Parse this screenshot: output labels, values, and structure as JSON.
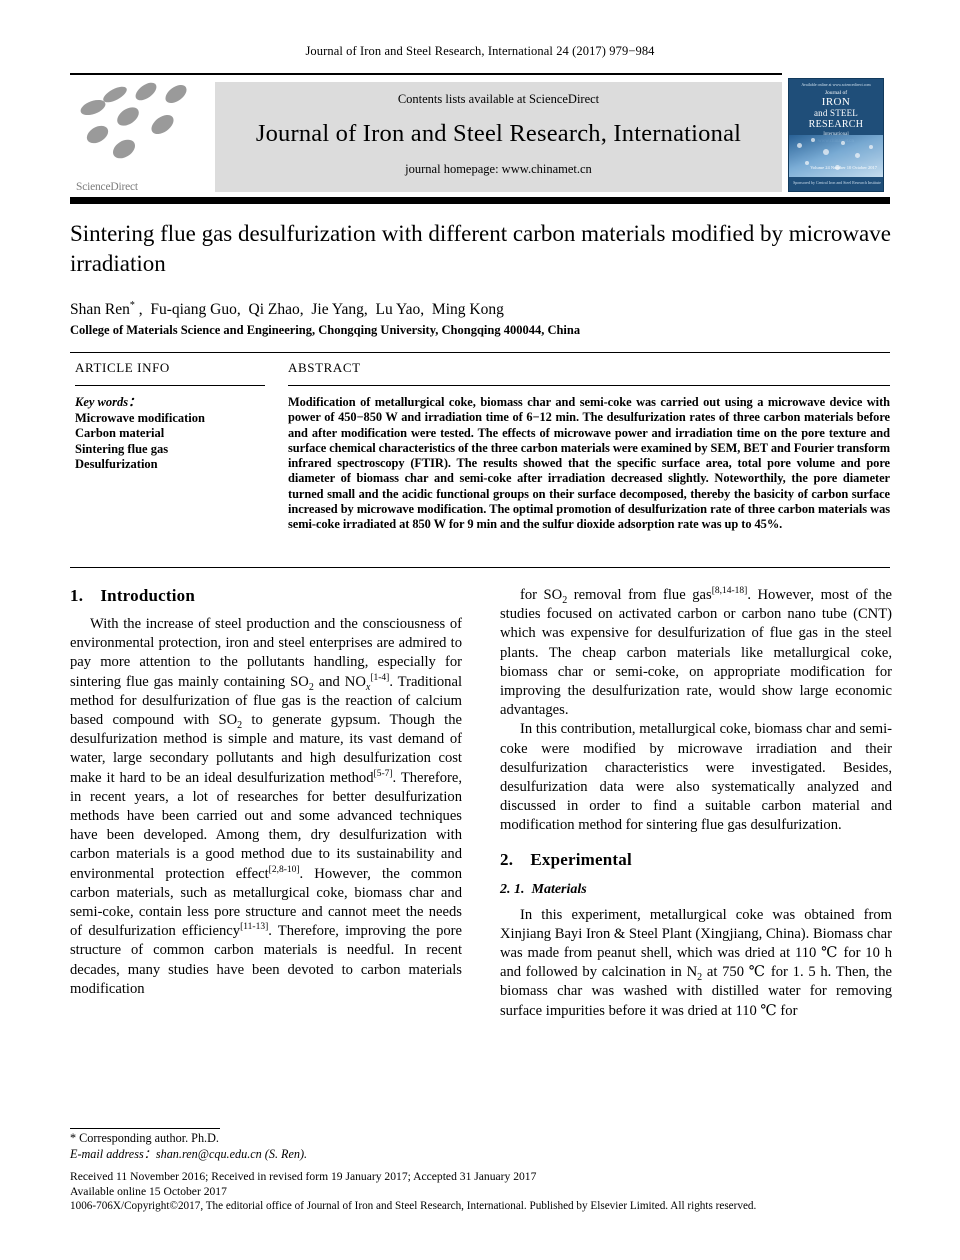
{
  "running_head": "Journal of Iron and Steel Research, International 24 (2017) 979−984",
  "masthead": {
    "contents_line": "Contents lists available at ScienceDirect",
    "journal_title": "Journal of Iron and Steel Research, International",
    "homepage_line": "journal homepage: www.chinamet.cn",
    "sciencedirect_label": "ScienceDirect",
    "cover": {
      "line_tiny": "Available online at www.sciencedirect.com",
      "line1": "Journal of",
      "line2": "IRON",
      "line3": "and STEEL",
      "line4": "RESEARCH",
      "line5": "International",
      "line6": "www.chinamet.cn",
      "issue": "Volume 24  Number 10\nOctober 2017",
      "bottom": "Sponsored by\nCentral Iron and Steel Research Institute"
    }
  },
  "title": "Sintering flue gas desulfurization with different carbon materials modified by microwave irradiation",
  "authors_html": "Shan Ren<sup>*</sup> ,  Fu-qiang Guo,  Qi Zhao,  Jie Yang,  Lu Yao,  Ming Kong",
  "affiliation": "College of Materials Science and Engineering, Chongqing University, Chongqing 400044, China",
  "article_info": {
    "heading": "ARTICLE INFO",
    "keywords_heading": "Key words：",
    "keywords": [
      "Microwave modification",
      "Carbon material",
      "Sintering flue gas",
      "Desulfurization"
    ]
  },
  "abstract": {
    "heading": "ABSTRACT",
    "text": "Modification of metallurgical coke, biomass char and semi-coke was carried out using a microwave device with power of 450−850 W and irradiation time of 6−12 min. The desulfurization rates of three carbon materials before and after modification were tested. The effects of microwave power and irradiation time on the pore texture and surface chemical characteristics of the three carbon materials were examined by SEM, BET and Fourier transform infrared spectroscopy (FTIR). The results showed that the specific surface area, total pore volume and pore diameter of biomass char and semi-coke after irradiation decreased slightly. Noteworthily, the pore diameter turned small and the acidic functional groups on their surface decomposed, thereby the basicity of carbon surface increased by microwave modification. The optimal promotion of desulfurization rate of three carbon materials was semi-coke irradiated at 850 W for 9 min and the sulfur dioxide adsorption rate was up to 45%."
  },
  "sections": {
    "introduction_heading": "1. Introduction",
    "experimental_heading": "2. Experimental",
    "materials_heading": "2. 1. Materials"
  },
  "body": {
    "intro_p1_html": "With the increase of steel production and the consciousness of environmental protection, iron and steel enterprises are admired to pay more attention to the pollutants handling, especially for sintering flue gas mainly containing SO<sub>2</sub> and NO<sub><i>x</i></sub><sup>[1-4]</sup>. Traditional method for desulfurization of flue gas is the reaction of calcium based compound with SO<sub>2</sub> to generate gypsum. Though the desulfurization method is simple and mature, its vast demand of water, large secondary pollutants and high desulfurization cost make it hard to be an ideal desulfurization method<sup>[5-7]</sup>. Therefore, in recent years, a lot of researches for better desulfurization methods have been carried out and some advanced techniques have been developed. Among them, dry desulfurization with carbon materials is a good method due to its sustainability and environmental protection effect<sup>[2,8-10]</sup>. However, the common carbon materials, such as metallurgical coke, biomass char and semi-coke, contain less pore structure and cannot meet the needs of desulfurization efficiency<sup>[11-13]</sup>. Therefore, improving the pore structure of common carbon materials is needful. In recent decades, many studies have been devoted to carbon materials modification",
    "right_p1_html": "for SO<sub>2</sub> removal from flue gas<sup>[8,14-18]</sup>. However, most of the studies focused on activated carbon or carbon nano tube (CNT) which was expensive for desulfurization of flue gas in the steel plants. The cheap carbon materials like metallurgical coke, biomass char or semi-coke, on appropriate modification for improving the desulfurization rate, would show large economic advantages.",
    "right_p2_html": "In this contribution, metallurgical coke, biomass char and semi-coke were modified by microwave irradiation and their desulfurization characteristics were investigated. Besides, desulfurization data were also systematically analyzed and discussed in order to find a suitable carbon material and modification method for sintering flue gas desulfurization.",
    "materials_p1_html": "In this experiment, metallurgical coke was obtained from Xinjiang Bayi Iron &amp; Steel Plant (Xingjiang, China). Biomass char was made from peanut shell, which was dried at 110 ℃ for 10 h and followed by calcination in N<sub>2</sub> at 750 ℃ for 1. 5 h. Then, the biomass char was washed with distilled water for removing surface impurities before it was dried at 110 ℃ for"
  },
  "footer": {
    "corresponding": "*  Corresponding author. Ph.D.",
    "email_label": "E-mail address：",
    "email_value": "shan.ren@cqu.edu.cn",
    "email_suffix": "(S. Ren).",
    "received": "Received 11 November 2016; Received in revised form 19 January 2017; Accepted 31 January 2017",
    "available": "Available online 15 October 2017",
    "copyright": "1006-706X/Copyright©2017, The editorial office of Journal of Iron and Steel Research, International. Published by Elsevier Limited. All rights reserved."
  }
}
